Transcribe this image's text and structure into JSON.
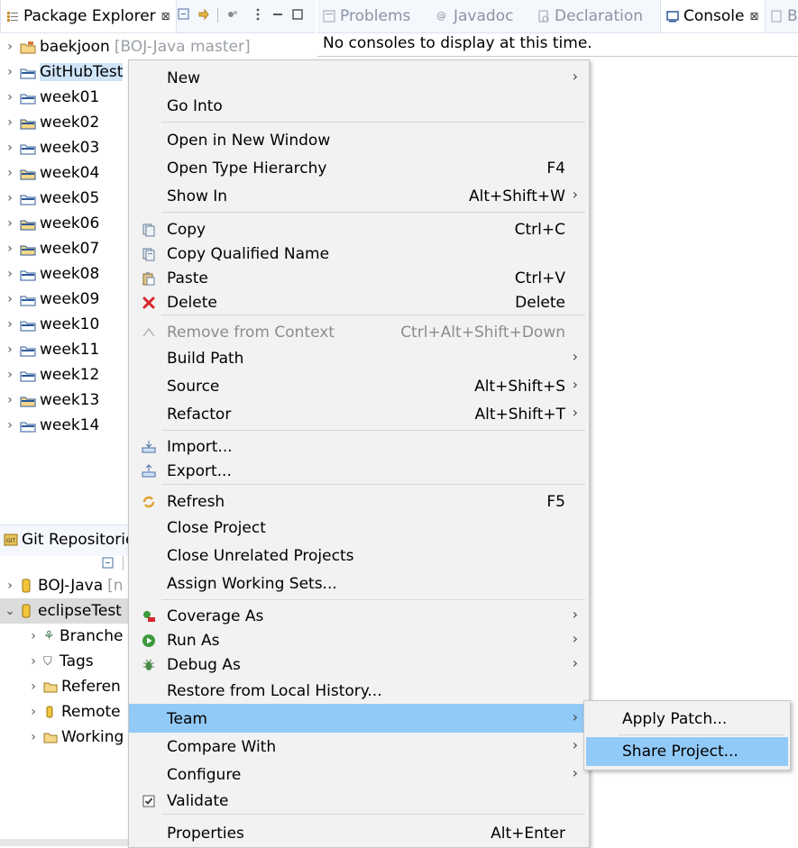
{
  "left_tabs": {
    "package_explorer": "Package Explorer",
    "close_glyph": "⊠"
  },
  "right_tabs": [
    {
      "label": "Problems",
      "icon": "problems-icon"
    },
    {
      "label": "Javadoc",
      "icon": "javadoc-icon"
    },
    {
      "label": "Declaration",
      "icon": "declaration-icon"
    },
    {
      "label": "Console",
      "icon": "console-icon"
    },
    {
      "label": "B",
      "icon": "bookmark-icon"
    }
  ],
  "console_close": "⊠",
  "console": {
    "message": "No consoles to display at this time."
  },
  "tree": [
    {
      "label": "baekjoon",
      "suffix": "[BOJ-Java master]"
    },
    {
      "label": "GitHubTest",
      "suffix": ""
    },
    {
      "label": "week01"
    },
    {
      "label": "week02"
    },
    {
      "label": "week03"
    },
    {
      "label": "week04"
    },
    {
      "label": "week05"
    },
    {
      "label": "week06"
    },
    {
      "label": "week07"
    },
    {
      "label": "week08"
    },
    {
      "label": "week09"
    },
    {
      "label": "week10"
    },
    {
      "label": "week11"
    },
    {
      "label": "week12"
    },
    {
      "label": "week13"
    },
    {
      "label": "week14"
    }
  ],
  "git": {
    "title": "Git Repositorie",
    "repos": [
      {
        "label": "BOJ-Java",
        "suffix": "[n"
      },
      {
        "label": "eclipseTest",
        "suffix": ""
      }
    ],
    "children": [
      "Branche",
      "Tags",
      "Referen",
      "Remote",
      "Working"
    ]
  },
  "menu": {
    "new": "New",
    "go_into": "Go Into",
    "open_new_window": "Open in New Window",
    "open_type_hierarchy": "Open Type Hierarchy",
    "open_type_hierarchy_sc": "F4",
    "show_in": "Show In",
    "show_in_sc": "Alt+Shift+W",
    "copy": "Copy",
    "copy_sc": "Ctrl+C",
    "copy_qualified": "Copy Qualified Name",
    "paste": "Paste",
    "paste_sc": "Ctrl+V",
    "delete": "Delete",
    "delete_sc": "Delete",
    "remove_context": "Remove from Context",
    "remove_context_sc": "Ctrl+Alt+Shift+Down",
    "build_path": "Build Path",
    "source": "Source",
    "source_sc": "Alt+Shift+S",
    "refactor": "Refactor",
    "refactor_sc": "Alt+Shift+T",
    "import": "Import...",
    "export": "Export...",
    "refresh": "Refresh",
    "refresh_sc": "F5",
    "close_project": "Close Project",
    "close_unrelated": "Close Unrelated Projects",
    "assign_sets": "Assign Working Sets...",
    "coverage_as": "Coverage As",
    "run_as": "Run As",
    "debug_as": "Debug As",
    "restore_history": "Restore from Local History...",
    "team": "Team",
    "compare_with": "Compare With",
    "configure": "Configure",
    "validate": "Validate",
    "properties": "Properties",
    "properties_sc": "Alt+Enter",
    "arrow": "›"
  },
  "submenu": {
    "apply_patch": "Apply Patch...",
    "share_project": "Share Project..."
  }
}
